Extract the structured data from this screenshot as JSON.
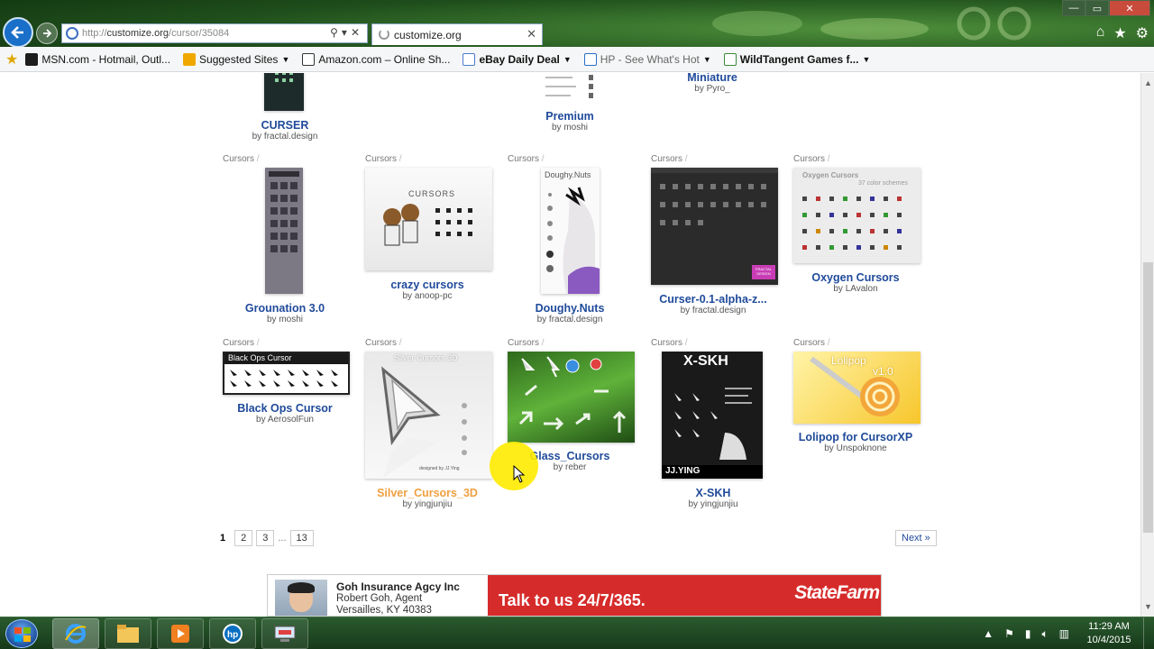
{
  "browser": {
    "address": {
      "prefix": "http://",
      "domain": "customize.org",
      "path": "/cursor/35084"
    },
    "tab_title": "customize.org",
    "favorites": [
      {
        "label": "MSN.com - Hotmail, Outl...",
        "icon": "msn-icon",
        "color": "#1d1d1d",
        "dropdown": false
      },
      {
        "label": "Suggested Sites",
        "icon": "bing-icon",
        "color": "#f0a800",
        "dropdown": true
      },
      {
        "label": "Amazon.com – Online Sh...",
        "icon": "amazon-icon",
        "color": "#222222",
        "dropdown": false
      },
      {
        "label": "eBay Daily Deal",
        "icon": "ebay-icon",
        "color": "#4a7bd0",
        "dropdown": true
      },
      {
        "label": "HP - See What's Hot",
        "icon": "hp-icon",
        "color": "#2a6ec8",
        "dropdown": true
      },
      {
        "label": "WildTangent Games f...",
        "icon": "wildtangent-icon",
        "color": "#3a8a3a",
        "dropdown": true
      }
    ]
  },
  "page": {
    "items": [
      {
        "id": "curser",
        "cat": "",
        "title": "CURSER",
        "author": "fractal.design",
        "visited": false
      },
      {
        "id": "premium",
        "cat": "",
        "title": "Premium",
        "author": "moshi",
        "visited": false
      },
      {
        "id": "miniature",
        "cat": "",
        "title": "Miniature",
        "author": "Pyro_",
        "visited": false
      },
      {
        "id": "grounation",
        "cat": "Cursors",
        "title": "Grounation 3.0",
        "author": "moshi",
        "visited": false
      },
      {
        "id": "crazy",
        "cat": "Cursors",
        "title": "crazy cursors",
        "author": "anoop-pc",
        "visited": false
      },
      {
        "id": "doughy",
        "cat": "Cursors",
        "title": "Doughy.Nuts",
        "author": "fractal.design",
        "visited": false
      },
      {
        "id": "curseralpha",
        "cat": "Cursors",
        "title": "Curser-0.1-alpha-z...",
        "author": "fractal.design",
        "visited": false
      },
      {
        "id": "oxygen",
        "cat": "Cursors",
        "title": "Oxygen Cursors",
        "author": "LAvalon",
        "visited": false
      },
      {
        "id": "blackops",
        "cat": "Cursors",
        "title": "Black Ops Cursor",
        "author": "AerosolFun",
        "visited": false
      },
      {
        "id": "silver",
        "cat": "Cursors",
        "title": "Silver_Cursors_3D",
        "author": "yingjunjiu",
        "visited": true
      },
      {
        "id": "glass",
        "cat": "Cursors",
        "title": "Glass_Cursors",
        "author": "reber",
        "visited": false
      },
      {
        "id": "xskh",
        "cat": "Cursors",
        "title": "X-SKH",
        "author": "yingjunjiu",
        "visited": false
      },
      {
        "id": "lolipop",
        "cat": "Cursors",
        "title": "Lolipop for CursorXP",
        "author": "Unspoknone",
        "visited": false
      }
    ],
    "by_prefix": "by",
    "cat_sep": "/",
    "thumb_text": {
      "crazy": "CURSORS",
      "doughy": "Doughy.Nuts",
      "oxygen_title": "Oxygen Cursors",
      "oxygen_sub": "37 color schemes",
      "blackops": "Black Ops Cursor",
      "silver_title": "Silver Cursors 3D",
      "silver_credit": "designed by JJ.Ying",
      "xskh": "X-SKH",
      "xskh_sig": "JJ.YING",
      "lolipop": "Lolipop",
      "lolipop_ver": "v1.0",
      "fractal_tag": "FRACTAL DESIGN"
    },
    "pager": {
      "current": "1",
      "pages": [
        "2",
        "3"
      ],
      "ellipsis": "...",
      "last": "13",
      "next": "Next »"
    }
  },
  "ad": {
    "agency": "Goh Insurance Agcy Inc",
    "agent": "Robert Goh, Agent",
    "location": "Versailles, KY 40383",
    "tagline": "Talk to us 24/7/365.",
    "brand": "StateFarm"
  },
  "taskbar": {
    "time": "11:29 AM",
    "date": "10/4/2015"
  },
  "colors": {
    "accent": "#1f4a9a",
    "visited": "#f0a040",
    "ad_red": "#d62b2b"
  }
}
